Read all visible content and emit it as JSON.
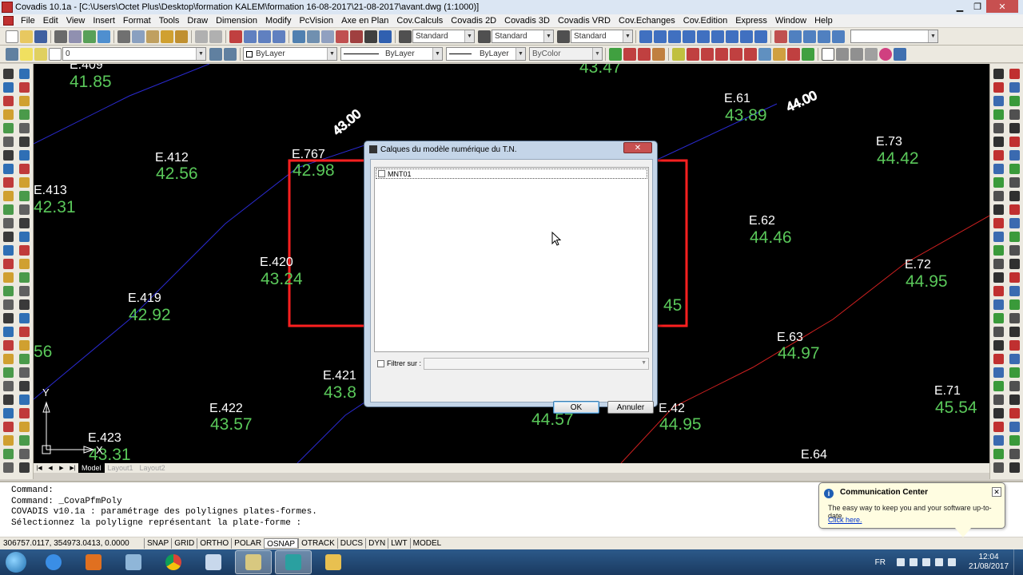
{
  "window": {
    "title": "Covadis 10.1a - [C:\\Users\\Octet Plus\\Desktop\\formation KALEM\\formation 16-08-2017\\21-08-2017\\avant.dwg (1:1000)]"
  },
  "menu": [
    "File",
    "Edit",
    "View",
    "Insert",
    "Format",
    "Tools",
    "Draw",
    "Dimension",
    "Modify",
    "PcVision",
    "Axe en Plan",
    "Cov.Calculs",
    "Covadis 2D",
    "Covadis 3D",
    "Covadis VRD",
    "Cov.Echanges",
    "Cov.Edition",
    "Express",
    "Window",
    "Help"
  ],
  "toolbar": {
    "text_style": "Standard",
    "dim_style": "Standard",
    "table_style": "Standard",
    "layer": "0",
    "color": "ByLayer",
    "linetype": "ByLayer",
    "lineweight": "ByLayer",
    "plotstyle": "ByColor"
  },
  "drawing": {
    "contour_labels": [
      "43.00",
      "44.00"
    ],
    "points": [
      {
        "id": "E.409",
        "z": "41.85"
      },
      {
        "id": "",
        "z": "43.47"
      },
      {
        "id": "E.61",
        "z": "43.89"
      },
      {
        "id": "E.412",
        "z": "42.56"
      },
      {
        "id": "E.767",
        "z": "42.98"
      },
      {
        "id": "E.73",
        "z": "44.42"
      },
      {
        "id": "E.413",
        "z": "42.31"
      },
      {
        "id": "E.62",
        "z": "44.46"
      },
      {
        "id": "E.420",
        "z": "43.24"
      },
      {
        "id": "E.72",
        "z": "44.95"
      },
      {
        "id": "",
        "z": "45"
      },
      {
        "id": "E.419",
        "z": "42.92"
      },
      {
        "id": "E.63",
        "z": "44.97"
      },
      {
        "id": "",
        "z": "56"
      },
      {
        "id": "E.421",
        "z": "43.8"
      },
      {
        "id": "E.71",
        "z": "45.54"
      },
      {
        "id": "E.422",
        "z": "43.57"
      },
      {
        "id": "",
        "z": "44.57"
      },
      {
        "id": "E.42",
        "z": "44.95"
      },
      {
        "id": "E.423",
        "z": "43.31"
      },
      {
        "id": "E.64",
        "z": ""
      }
    ],
    "ucs_y": "Y",
    "ucs_x": "X"
  },
  "layout_tabs": [
    "Model",
    "Layout1",
    "Layout2"
  ],
  "command_lines": [
    "Command:",
    "Command: _CovaPfmPoly",
    "COVADIS v10.1a : paramétrage des polylignes plates-formes.",
    "",
    "Sélectionnez la polyligne représentant la plate-forme :"
  ],
  "status": {
    "coords": "306757.0117, 354973.0413, 0.0000",
    "buttons": [
      "SNAP",
      "GRID",
      "ORTHO",
      "POLAR",
      "OSNAP",
      "OTRACK",
      "DUCS",
      "DYN",
      "LWT",
      "MODEL"
    ],
    "active": [
      "OSNAP"
    ]
  },
  "dialog": {
    "title": "Calques du modèle numérique du T.N.",
    "list_items": [
      "MNT01"
    ],
    "filter_label": "Filtrer sur :",
    "ok": "OK",
    "cancel": "Annuler"
  },
  "notification": {
    "title": "Communication Center",
    "text": "The easy way to keep you and your software up-to-date.",
    "link": "Click here."
  },
  "taskbar": {
    "lang": "FR",
    "time": "12:04",
    "date": "21/08/2017"
  },
  "colors": {
    "canvas": "#000000",
    "point_text": "#ffffff",
    "elevation_text": "#5ac85a",
    "contour_blue": "#2a2ad0",
    "contour_red": "#d02020",
    "platform_red": "#ff2020"
  }
}
